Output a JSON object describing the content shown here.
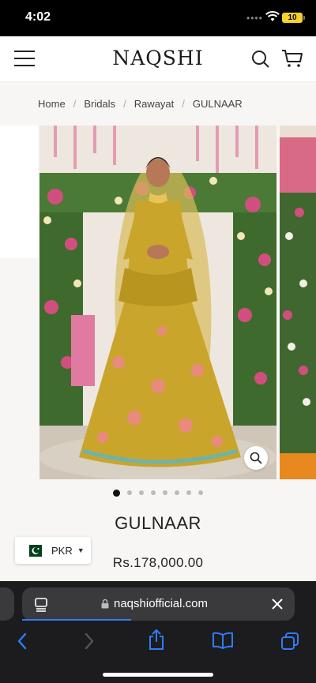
{
  "status_bar": {
    "time": "4:02",
    "battery": "10"
  },
  "header": {
    "logo": "NAQSHI"
  },
  "breadcrumb": [
    "Home",
    "Bridals",
    "Rawayat",
    "GULNAAR"
  ],
  "gallery": {
    "dot_count": 8,
    "active_index": 0
  },
  "product": {
    "title": "GULNAAR",
    "price": "Rs.178,000.00"
  },
  "currency": {
    "code": "PKR"
  },
  "browser": {
    "url": "naqshiofficial.com",
    "load_progress": 0.4
  },
  "colors": {
    "dress": "#c9a52b",
    "accent_pink": "#d14f7e",
    "link_blue": "#2f7cf6"
  }
}
